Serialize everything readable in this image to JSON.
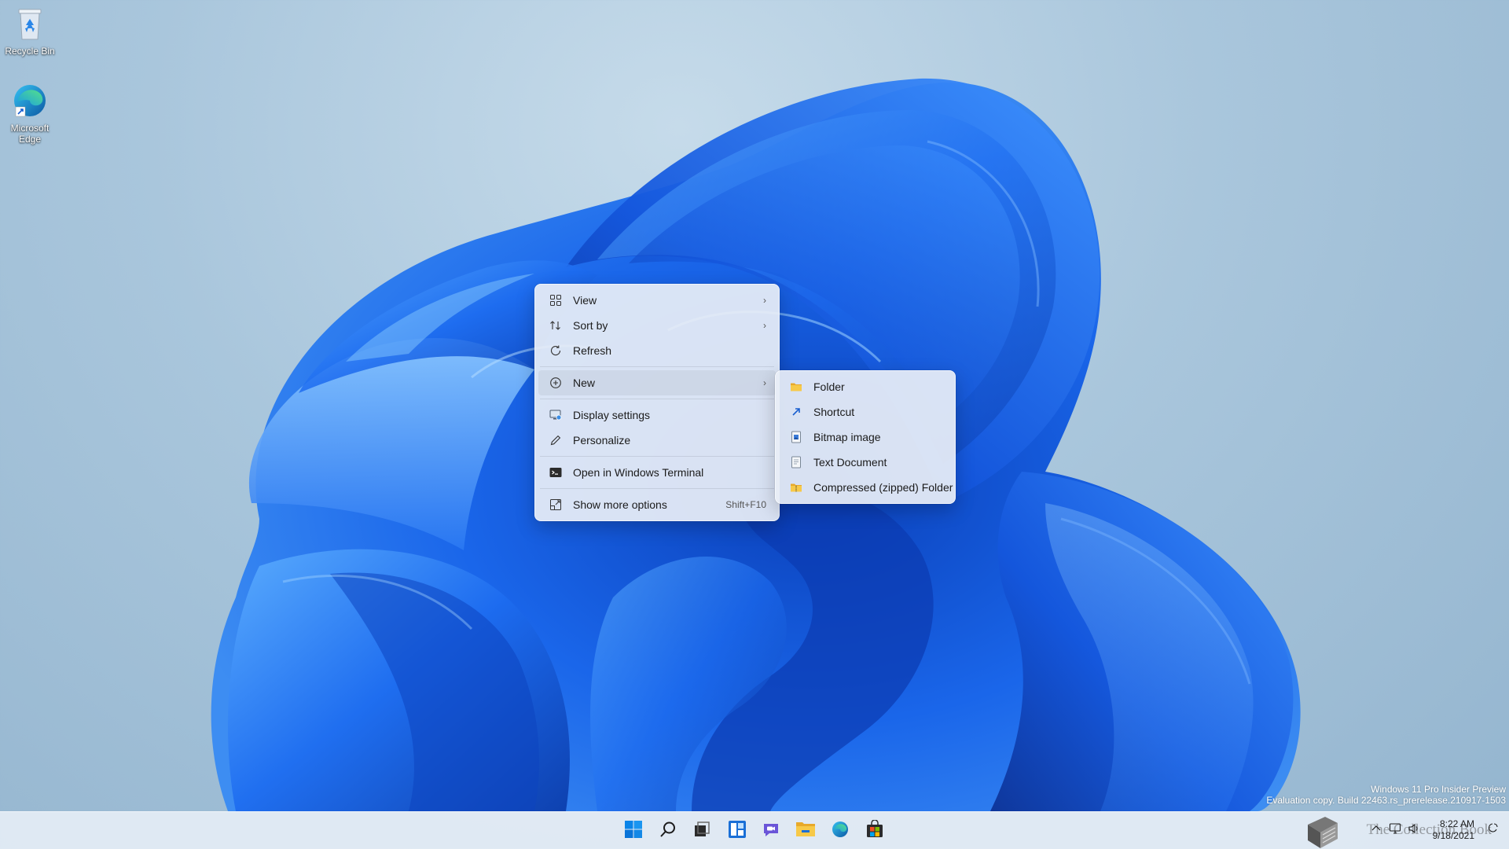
{
  "desktop": {
    "icons": [
      {
        "label": "Recycle Bin",
        "icon": "recycle-bin-icon"
      },
      {
        "label": "Microsoft Edge",
        "icon": "edge-icon"
      }
    ]
  },
  "context_menu": {
    "items": [
      {
        "label": "View",
        "icon": "grid-view-icon",
        "has_submenu": true
      },
      {
        "label": "Sort by",
        "icon": "sort-icon",
        "has_submenu": true
      },
      {
        "label": "Refresh",
        "icon": "refresh-icon"
      },
      {
        "label": "New",
        "icon": "plus-circle-icon",
        "has_submenu": true,
        "active": true
      },
      {
        "label": "Display settings",
        "icon": "display-icon"
      },
      {
        "label": "Personalize",
        "icon": "pen-icon"
      },
      {
        "label": "Open in Windows Terminal",
        "icon": "terminal-icon"
      },
      {
        "label": "Show more options",
        "icon": "more-options-icon",
        "accelerator": "Shift+F10"
      }
    ]
  },
  "new_submenu": {
    "items": [
      {
        "label": "Folder",
        "icon": "folder-icon"
      },
      {
        "label": "Shortcut",
        "icon": "shortcut-icon"
      },
      {
        "label": "Bitmap image",
        "icon": "bitmap-icon"
      },
      {
        "label": "Text Document",
        "icon": "text-document-icon"
      },
      {
        "label": "Compressed (zipped) Folder",
        "icon": "zip-folder-icon"
      }
    ]
  },
  "watermark": {
    "line1": "Windows 11 Pro Insider Preview",
    "line2": "Evaluation copy. Build 22463.rs_prerelease.210917-1503"
  },
  "taskbar": {
    "buttons": [
      "start-icon",
      "search-icon",
      "task-view-icon",
      "widgets-icon",
      "chat-icon",
      "file-explorer-icon",
      "edge-icon",
      "store-icon"
    ]
  },
  "tray": {
    "time": "8:22 AM",
    "date": "9/18/2021",
    "overlay_brand": "The Collection Book"
  },
  "colors": {
    "accent": "#0078d4",
    "wallpaper_bloom": "#1560e8",
    "folder": "#f6c343"
  }
}
